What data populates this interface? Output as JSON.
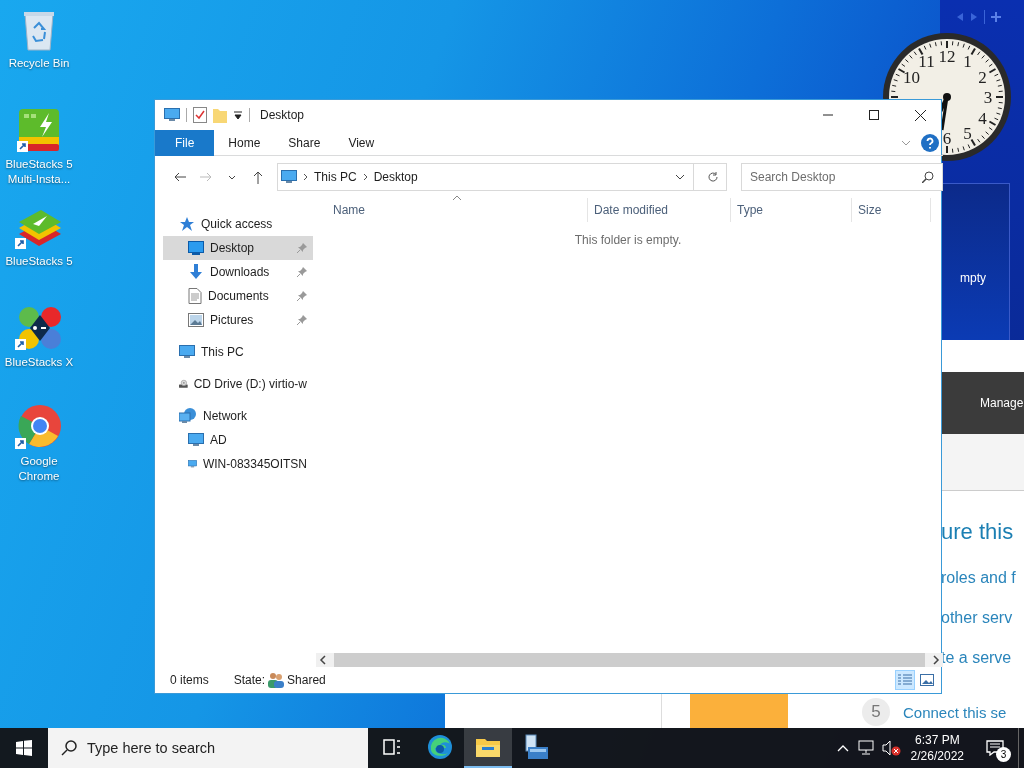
{
  "desktop_icons": [
    {
      "label": "Recycle Bin",
      "kind": "recycle"
    },
    {
      "label": "BlueStacks 5\nMulti-Insta...",
      "kind": "bluestacks-multi"
    },
    {
      "label": "BlueStacks 5",
      "kind": "bluestacks"
    },
    {
      "label": "BlueStacks X",
      "kind": "bluestacks-x"
    },
    {
      "label": "Google\nChrome",
      "kind": "chrome"
    }
  ],
  "gadgets": {
    "clock": {
      "numerals": [
        "10",
        "11",
        "12",
        "1",
        "2",
        "3",
        "4",
        "5",
        "6"
      ]
    },
    "panel_text": "mpty"
  },
  "server_manager": {
    "header": "Manage",
    "heading": "ure this",
    "links": [
      "roles and f",
      "other serv",
      "te a serve"
    ],
    "step": {
      "number": "5",
      "text": "Connect this se"
    }
  },
  "explorer": {
    "title": "Desktop",
    "ribbon_tabs": [
      {
        "label": "File",
        "selected": true
      },
      {
        "label": "Home",
        "selected": false
      },
      {
        "label": "Share",
        "selected": false
      },
      {
        "label": "View",
        "selected": false
      }
    ],
    "address": [
      "This PC",
      "Desktop"
    ],
    "search": {
      "placeholder": "Search Desktop"
    },
    "columns": [
      "Name",
      "Date modified",
      "Type",
      "Size"
    ],
    "empty_message": "This folder is empty.",
    "nav": [
      {
        "label": "Quick access",
        "kind": "star",
        "selected": false,
        "children": [
          {
            "label": "Desktop",
            "kind": "desktop",
            "selected": true,
            "pinned": true
          },
          {
            "label": "Downloads",
            "kind": "download",
            "selected": false,
            "pinned": true
          },
          {
            "label": "Documents",
            "kind": "document",
            "selected": false,
            "pinned": true
          },
          {
            "label": "Pictures",
            "kind": "picture",
            "selected": false,
            "pinned": true
          }
        ]
      },
      {
        "label": "This PC",
        "kind": "pc",
        "selected": false
      },
      {
        "label": "CD Drive (D:) virtio-w",
        "kind": "cd",
        "selected": false
      },
      {
        "label": "Network",
        "kind": "network",
        "selected": false,
        "children": [
          {
            "label": "AD",
            "kind": "pc",
            "selected": false
          },
          {
            "label": "WIN-083345OITSN",
            "kind": "pc",
            "selected": false
          }
        ]
      }
    ],
    "status": {
      "count": "0 items",
      "state_label": "State:",
      "state": "Shared"
    },
    "views": [
      {
        "kind": "details",
        "selected": true
      },
      {
        "kind": "large",
        "selected": false
      }
    ]
  },
  "taskbar": {
    "search_placeholder": "Type here to search",
    "apps": [
      {
        "kind": "taskview",
        "selected": false
      },
      {
        "kind": "edge",
        "selected": false
      },
      {
        "kind": "explorer",
        "selected": true
      },
      {
        "kind": "servermanager",
        "selected": false
      }
    ],
    "time": "6:37 PM",
    "date": "2/26/2022",
    "notifications": "3"
  }
}
